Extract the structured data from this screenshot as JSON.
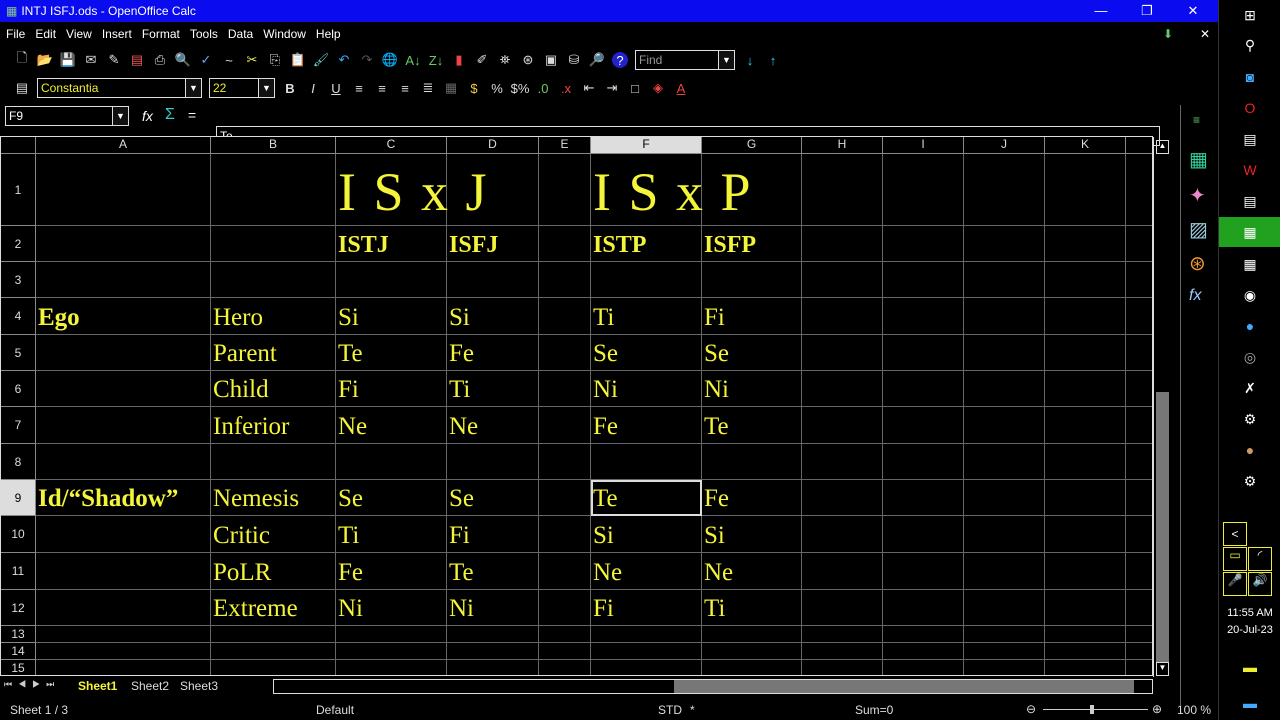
{
  "window": {
    "title": "INTJ ISFJ.ods - OpenOffice Calc",
    "minimize": "—",
    "restore": "❐",
    "close": "✕"
  },
  "menu": [
    "File",
    "Edit",
    "View",
    "Insert",
    "Format",
    "Tools",
    "Data",
    "Window",
    "Help"
  ],
  "toolbar": {
    "find_placeholder": "Find",
    "font_name": "Constantia",
    "font_size": "22"
  },
  "formula": {
    "cell_ref": "F9",
    "content": "Te",
    "fx": "fx",
    "sum": "Σ",
    "equals": "="
  },
  "columns": [
    "A",
    "B",
    "C",
    "D",
    "E",
    "F",
    "G",
    "H",
    "I",
    "J",
    "K"
  ],
  "rows": [
    "1",
    "2",
    "3",
    "4",
    "5",
    "6",
    "7",
    "8",
    "9",
    "10",
    "11",
    "12",
    "13",
    "14",
    "15"
  ],
  "selected_cell": "F9",
  "cells": {
    "C1": "I S x J",
    "F1": "I S x P",
    "C2": "ISTJ",
    "D2": "ISFJ",
    "F2": "ISTP",
    "G2": "ISFP",
    "A4": "Ego",
    "B4": "Hero",
    "C4": "Si",
    "D4": "Si",
    "F4": "Ti",
    "G4": "Fi",
    "B5": "Parent",
    "C5": "Te",
    "D5": "Fe",
    "F5": "Se",
    "G5": "Se",
    "B6": "Child",
    "C6": "Fi",
    "D6": "Ti",
    "F6": "Ni",
    "G6": "Ni",
    "B7": "Inferior",
    "C7": "Ne",
    "D7": "Ne",
    "F7": "Fe",
    "G7": "Te",
    "A9": "Id/“Shadow”",
    "B9": "Nemesis",
    "C9": "Se",
    "D9": "Se",
    "F9": "Te",
    "G9": "Fe",
    "B10": "Critic",
    "C10": "Ti",
    "D10": "Fi",
    "F10": "Si",
    "G10": "Si",
    "B11": "PoLR",
    "C11": "Fe",
    "D11": "Te",
    "F11": "Ne",
    "G11": "Ne",
    "B12": "Extreme",
    "C12": "Ni",
    "D12": "Ni",
    "F12": "Fi",
    "G12": "Ti"
  },
  "sheets": [
    "Sheet1",
    "Sheet2",
    "Sheet3"
  ],
  "active_sheet": "Sheet1",
  "status": {
    "sheet": "Sheet 1 / 3",
    "style": "Default",
    "mode": "STD",
    "modified": "*",
    "sum": "Sum=0",
    "zoom": "100 %"
  },
  "clock": {
    "time": "11:55 AM",
    "date": "20-Jul-23"
  },
  "text_color": "#f4f43a"
}
